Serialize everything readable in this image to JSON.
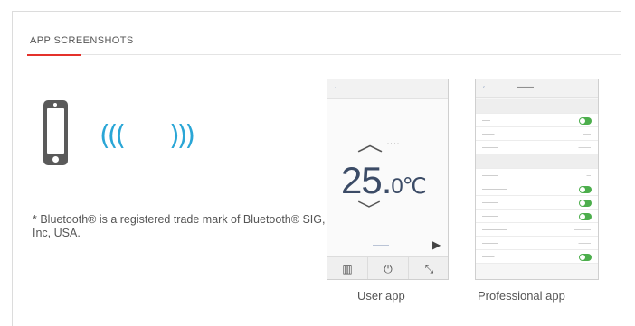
{
  "section": {
    "title": "APP SCREENSHOTS"
  },
  "colors": {
    "accent": "#e4312b",
    "wave": "#2aa6d6",
    "phone": "#5a5a5a",
    "toggle": "#4cae4c"
  },
  "icons": {
    "phone": "smartphone-icon",
    "wave_left": "signal-waves-left-icon",
    "wave_right": "signal-waves-right-icon"
  },
  "waves": {
    "left": "(((",
    "right": ")))"
  },
  "footnote": "* Bluetooth® is a registered trade mark of Bluetooth® SIG, Inc, USA.",
  "user_app": {
    "temperature_int": "25.",
    "temperature_dec": "0",
    "unit": "℃",
    "up_arrow": "︿",
    "down_arrow": "﹀",
    "play": "▶",
    "bottom_icons": [
      "▥",
      "⏻",
      "⤡"
    ],
    "caption": "User app"
  },
  "professional_app": {
    "caption": "Professional app"
  }
}
